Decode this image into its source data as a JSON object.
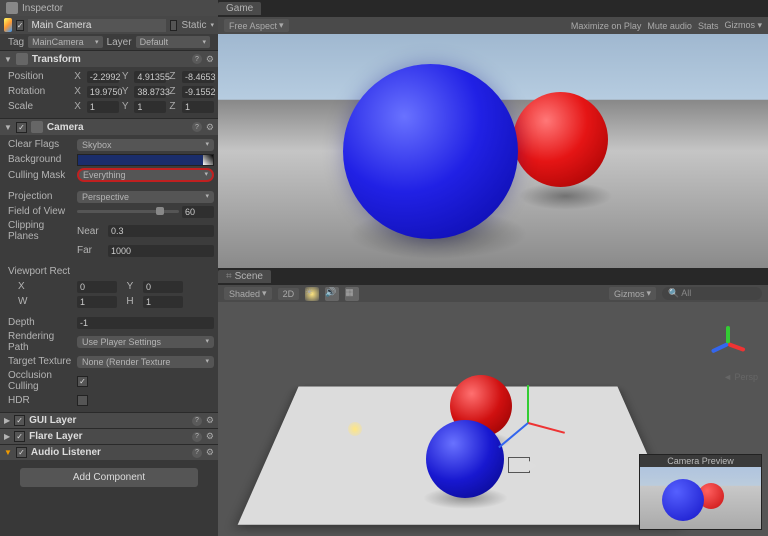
{
  "inspector": {
    "title": "Inspector",
    "object_name": "Main Camera",
    "static_label": "Static",
    "tag_label": "Tag",
    "tag_value": "MainCamera",
    "layer_label": "Layer",
    "layer_value": "Default"
  },
  "transform": {
    "title": "Transform",
    "position": {
      "label": "Position",
      "x": "-2.2992",
      "y": "4.91355",
      "z": "-8.4653"
    },
    "rotation": {
      "label": "Rotation",
      "x": "19.9750",
      "y": "38.8733",
      "z": "-9.1552"
    },
    "scale": {
      "label": "Scale",
      "x": "1",
      "y": "1",
      "z": "1"
    }
  },
  "camera": {
    "title": "Camera",
    "clear_flags": {
      "label": "Clear Flags",
      "value": "Skybox"
    },
    "background": {
      "label": "Background",
      "hex": "#1b2e6b"
    },
    "culling_mask": {
      "label": "Culling Mask",
      "value": "Everything"
    },
    "projection": {
      "label": "Projection",
      "value": "Perspective"
    },
    "fov": {
      "label": "Field of View",
      "value": "60"
    },
    "clipping": {
      "label": "Clipping Planes",
      "near_label": "Near",
      "near": "0.3",
      "far_label": "Far",
      "far": "1000"
    },
    "viewport": {
      "label": "Viewport Rect",
      "x": "0",
      "y": "0",
      "w": "1",
      "h": "1"
    },
    "depth": {
      "label": "Depth",
      "value": "-1"
    },
    "rendering_path": {
      "label": "Rendering Path",
      "value": "Use Player Settings"
    },
    "target_texture": {
      "label": "Target Texture",
      "value": "None (Render Texture"
    },
    "occlusion": {
      "label": "Occlusion Culling",
      "checked": true
    },
    "hdr": {
      "label": "HDR",
      "checked": false
    }
  },
  "components": {
    "gui_layer": "GUI Layer",
    "flare_layer": "Flare Layer",
    "audio_listener": "Audio Listener"
  },
  "add_component": "Add Component",
  "game": {
    "tab": "Game",
    "aspect": "Free Aspect",
    "maximize": "Maximize on Play",
    "mute": "Mute audio",
    "stats": "Stats",
    "gizmos": "Gizmos"
  },
  "scene": {
    "tab": "Scene",
    "shaded": "Shaded",
    "twod": "2D",
    "gizmos": "Gizmos",
    "search_ph": "All",
    "persp": "Persp",
    "preview_title": "Camera Preview"
  },
  "axis_labels": {
    "x": "X",
    "y": "Y",
    "z": "Z",
    "w": "W",
    "h": "H"
  }
}
